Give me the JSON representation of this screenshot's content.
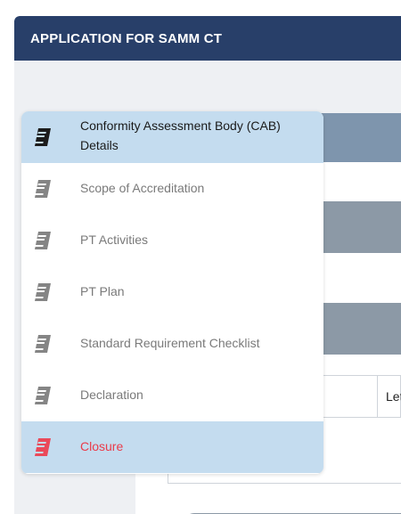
{
  "header": {
    "title": "APPLICATION FOR SAMM CT"
  },
  "background": {
    "table_cell": "Lette"
  },
  "menu": {
    "items": [
      {
        "label": "Conformity Assessment Body (CAB) Details",
        "state": "active",
        "icon": "book-icon",
        "icon_color": "#1c1c1c"
      },
      {
        "label": "Scope of Accreditation",
        "state": "inactive",
        "icon": "book-icon",
        "icon_color": "#858585"
      },
      {
        "label": "PT Activities",
        "state": "inactive",
        "icon": "book-icon",
        "icon_color": "#858585"
      },
      {
        "label": "PT Plan",
        "state": "inactive",
        "icon": "book-icon",
        "icon_color": "#858585"
      },
      {
        "label": "Standard Requirement Checklist",
        "state": "inactive",
        "icon": "book-icon",
        "icon_color": "#858585"
      },
      {
        "label": "Declaration",
        "state": "inactive",
        "icon": "book-icon",
        "icon_color": "#858585"
      },
      {
        "label": "Closure",
        "state": "highlight",
        "icon": "book-icon",
        "icon_color": "#ea4a5a"
      }
    ]
  },
  "colors": {
    "header_bg": "#283f69",
    "active_bg": "#c4dcef",
    "closure_text": "#ea3b4a"
  }
}
